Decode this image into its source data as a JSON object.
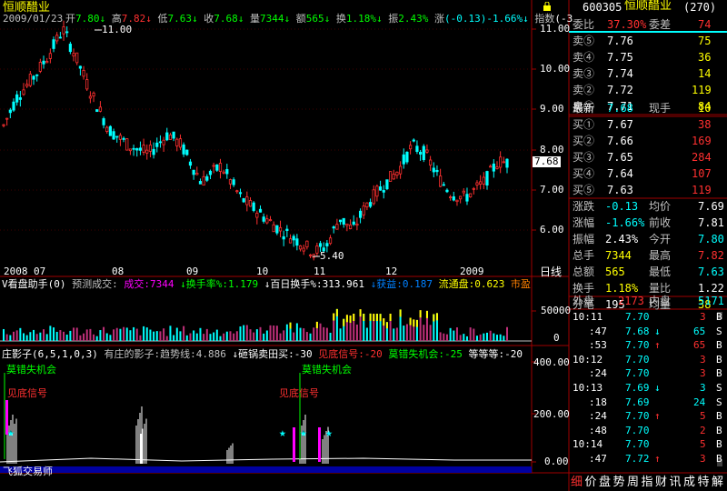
{
  "colors": {
    "up": "#ff3030",
    "down": "#00ffff",
    "grid": "#800000",
    "yellow": "#ffff00",
    "green": "#00ff00",
    "magenta": "#ff00ff",
    "white": "#ffffff"
  },
  "main": {
    "title": "恒顺醋业",
    "date": "2009/01/23",
    "stats": [
      {
        "label": "开",
        "value": "7.80",
        "arrow": "↓",
        "color": "#00ff00"
      },
      {
        "label": "高",
        "value": "7.82",
        "arrow": "↓",
        "color": "#ff3030"
      },
      {
        "label": "低",
        "value": "7.63",
        "arrow": "↓",
        "color": "#00ff00"
      },
      {
        "label": "收",
        "value": "7.68",
        "arrow": "↓",
        "color": "#00ff00"
      },
      {
        "label": "量",
        "value": "7344",
        "arrow": "↓",
        "color": "#00ff00"
      },
      {
        "label": "额",
        "value": "565",
        "arrow": "↓",
        "color": "#00ff00"
      },
      {
        "label": "换",
        "value": "1.18%",
        "arrow": "↓",
        "color": "#00ff00"
      },
      {
        "label": "振",
        "value": "2.43%",
        "arrow": "",
        "color": "#00ff00"
      },
      {
        "label": "涨",
        "value": "(-0.13)-1.66%",
        "arrow": "↓",
        "color": "#00ffff"
      },
      {
        "label": "指数",
        "value": "(-3",
        "arrow": "",
        "color": "#ffffff"
      }
    ],
    "high_label": "11.00",
    "low_label": "5.40",
    "current_price_tag": "7.68",
    "price_axis": [
      "11.00",
      "10.00",
      "9.00",
      "8.00",
      "7.00",
      "6.00"
    ],
    "time_axis": [
      "2008",
      "07",
      "08",
      "09",
      "10",
      "11",
      "12",
      "2009"
    ],
    "period_label": "日线",
    "lock_icon": "lock-icon"
  },
  "volume_panel": {
    "title": "V看盘助手(0)",
    "items": [
      {
        "text": "预测成交:",
        "color": "#c0c0c0"
      },
      {
        "text": "成交:7344",
        "color": "#ff00ff"
      },
      {
        "text": "↓换手率%:1.179",
        "color": "#00ff00"
      },
      {
        "text": "↓百日换手%:313.961",
        "color": "#ffffff"
      },
      {
        "text": "↓获益:0.187",
        "color": "#0080ff"
      },
      {
        "text": "流通盘:0.623",
        "color": "#ffff00"
      },
      {
        "text": "市盈",
        "color": "#ff8000"
      }
    ],
    "axis": [
      "50000",
      "0"
    ]
  },
  "ind_panel": {
    "title": "庄影子(6,5,1,0,3)",
    "items": [
      {
        "text": "有庄的影子:趋势线:4.886",
        "color": "#c0c0c0"
      },
      {
        "text": "↓砸锅卖田买:-30",
        "color": "#ffffff"
      },
      {
        "text": "见底信号:-20",
        "color": "#ff3030"
      },
      {
        "text": "莫错失机会:-25",
        "color": "#00ff00"
      },
      {
        "text": "等等等:-20",
        "color": "#ffffff"
      }
    ],
    "axis": [
      "400.00",
      "200.00",
      "0.00"
    ],
    "annotations": [
      {
        "text": "莫错失机会",
        "color": "#00ff00"
      },
      {
        "text": "见底信号",
        "color": "#ff3030"
      },
      {
        "text": "莫错失机会",
        "color": "#00ff00"
      },
      {
        "text": "见底信号",
        "color": "#ff3030"
      }
    ],
    "watermark": "飞狐交易师"
  },
  "quote": {
    "code": "600305",
    "name": "恒顺醋业",
    "count": "(270)",
    "weibi_label": "委比",
    "weibi": "37.30%",
    "weicha_label": "委差",
    "weicha": "74",
    "sells": [
      {
        "label": "卖⑤",
        "price": "7.76",
        "vol": "75"
      },
      {
        "label": "卖④",
        "price": "7.75",
        "vol": "36"
      },
      {
        "label": "卖③",
        "price": "7.74",
        "vol": "14"
      },
      {
        "label": "卖②",
        "price": "7.72",
        "vol": "119"
      },
      {
        "label": "卖①",
        "price": "7.71",
        "vol": "84"
      }
    ],
    "latest_label": "最新",
    "latest": "7.68",
    "xianshou_label": "现手",
    "xianshou": "10",
    "buys": [
      {
        "label": "买①",
        "price": "7.67",
        "vol": "38"
      },
      {
        "label": "买②",
        "price": "7.66",
        "vol": "169"
      },
      {
        "label": "买③",
        "price": "7.65",
        "vol": "284"
      },
      {
        "label": "买④",
        "price": "7.64",
        "vol": "107"
      },
      {
        "label": "买⑤",
        "price": "7.63",
        "vol": "119"
      }
    ],
    "stats": [
      {
        "l1": "涨跌",
        "v1": "-0.13",
        "c1": "#00ffff",
        "l2": "均价",
        "v2": "7.69",
        "c2": "#ffffff"
      },
      {
        "l1": "涨幅",
        "v1": "-1.66%",
        "c1": "#00ffff",
        "l2": "前收",
        "v2": "7.81",
        "c2": "#ffffff"
      },
      {
        "l1": "振幅",
        "v1": "2.43%",
        "c1": "#ffffff",
        "l2": "今开",
        "v2": "7.80",
        "c2": "#00ffff"
      },
      {
        "l1": "总手",
        "v1": "7344",
        "c1": "#ffff00",
        "l2": "最高",
        "v2": "7.82",
        "c2": "#ff3030"
      },
      {
        "l1": "总额",
        "v1": "565",
        "c1": "#ffff00",
        "l2": "最低",
        "v2": "7.63",
        "c2": "#00ffff"
      },
      {
        "l1": "换手",
        "v1": "1.18%",
        "c1": "#ffff00",
        "l2": "量比",
        "v2": "1.22",
        "c2": "#ffffff"
      },
      {
        "l1": "分笔",
        "v1": "195",
        "c1": "#ffffff",
        "l2": "均量",
        "v2": "38",
        "c2": "#ffff00"
      }
    ],
    "waipan_label": "外盘",
    "waipan": "2173",
    "neipan_label": "内盘",
    "neipan": "5171"
  },
  "ticks": [
    {
      "time": "10:11",
      "price": "7.70",
      "arrow": "",
      "vol": "3",
      "side": "B"
    },
    {
      "time": ":47",
      "price": "7.68",
      "arrow": "↓",
      "vol": "65",
      "side": "S"
    },
    {
      "time": ":53",
      "price": "7.70",
      "arrow": "↑",
      "vol": "65",
      "side": "B"
    },
    {
      "time": "10:12",
      "price": "7.70",
      "arrow": "",
      "vol": "3",
      "side": "B"
    },
    {
      "time": ":24",
      "price": "7.70",
      "arrow": "",
      "vol": "3",
      "side": "B"
    },
    {
      "time": "10:13",
      "price": "7.69",
      "arrow": "↓",
      "vol": "3",
      "side": "S"
    },
    {
      "time": ":18",
      "price": "7.69",
      "arrow": "",
      "vol": "24",
      "side": "S"
    },
    {
      "time": ":24",
      "price": "7.70",
      "arrow": "↑",
      "vol": "5",
      "side": "B"
    },
    {
      "time": ":48",
      "price": "7.70",
      "arrow": "",
      "vol": "2",
      "side": "B"
    },
    {
      "time": "10:14",
      "price": "7.70",
      "arrow": "",
      "vol": "5",
      "side": "B"
    },
    {
      "time": ":47",
      "price": "7.72",
      "arrow": "↑",
      "vol": "3",
      "side": "B"
    }
  ],
  "bottom_tabs": [
    "细",
    "价",
    "盘",
    "势",
    "周",
    "指",
    "财",
    "讯",
    "成",
    "特",
    "解"
  ]
}
